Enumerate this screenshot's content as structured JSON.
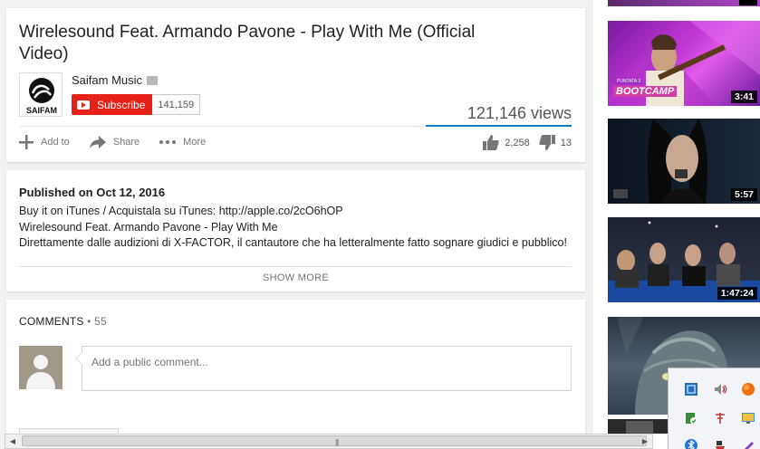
{
  "video": {
    "title": "Wirelesound Feat. Armando Pavone - Play With Me (Official Video)",
    "views": "121,146 views"
  },
  "channel": {
    "name": "Saifam Music",
    "logo_text": "SAIFAM",
    "subscribe_label": "Subscribe",
    "subscriber_count": "141,159"
  },
  "actions": {
    "add_to": "Add to",
    "share": "Share",
    "more": "More",
    "likes": "2,258",
    "dislikes": "13"
  },
  "description": {
    "published": "Published on Oct 12, 2016",
    "lines": [
      "Buy it on iTunes / Acquistala su iTunes: http://apple.co/2cO6hOP",
      "Wirelesound Feat. Armando Pavone - Play With Me",
      "Direttamente dalle audizioni di X-FACTOR, il cantautore che ha letteralmente fatto sognare giudici e pubblico!"
    ],
    "show_more": "SHOW MORE"
  },
  "comments": {
    "label": "COMMENTS",
    "count": "• 55",
    "placeholder": "Add a public comment..."
  },
  "sidebar": {
    "thumbnails": [
      {
        "duration": "3:41",
        "overlay_text": "BOOTCAMP",
        "overlay_small": "PUNTATA 3"
      },
      {
        "duration": "5:57"
      },
      {
        "duration": "1:47:24"
      },
      {
        "duration": ""
      }
    ]
  },
  "colors": {
    "subscribe_red": "#e62117",
    "views_bar_blue": "#167ac6",
    "page_bg": "#f1f1f1"
  }
}
